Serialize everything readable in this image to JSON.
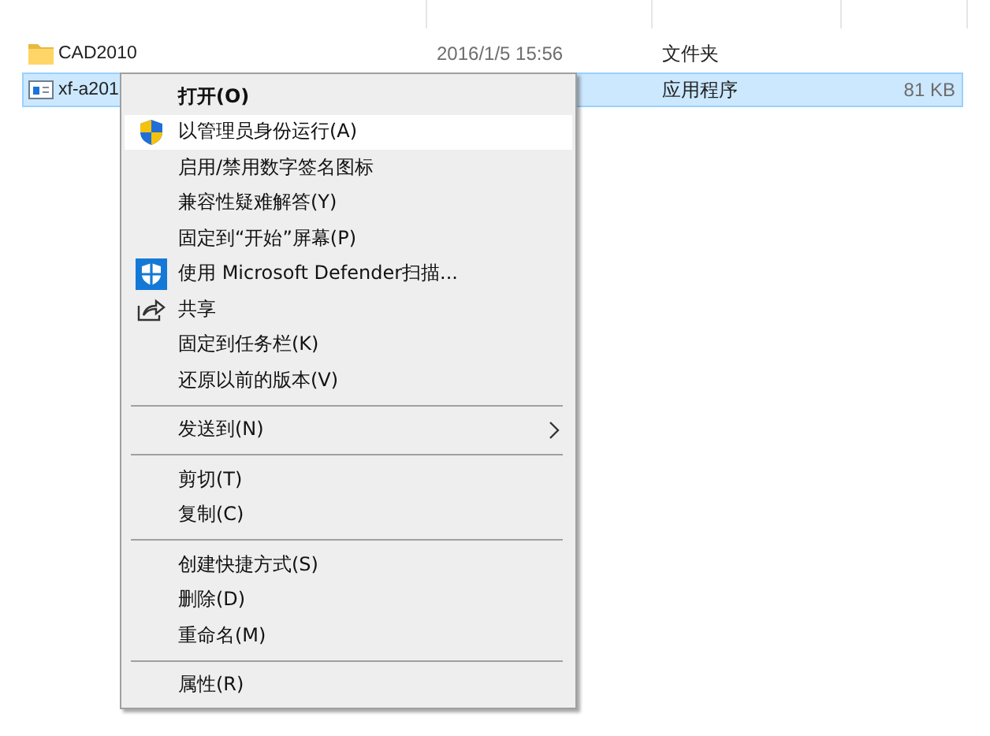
{
  "files": [
    {
      "name": "CAD2010",
      "date": "2016/1/5 15:56",
      "type": "文件夹",
      "kind": "folder",
      "selected": false
    },
    {
      "name": "xf-a201",
      "type": "应用程序",
      "size": "81 KB",
      "kind": "app",
      "selected": true
    }
  ],
  "context_menu": [
    {
      "kind": "item",
      "label": "打开(O)",
      "bold": true,
      "selected": false
    },
    {
      "kind": "shield_item",
      "label": "以管理员身份运行(A)",
      "selected": true
    },
    {
      "kind": "item",
      "label": "启用/禁用数字签名图标",
      "selected": false
    },
    {
      "kind": "item",
      "label": "兼容性疑难解答(Y)",
      "selected": false
    },
    {
      "kind": "item",
      "label": "固定到“开始”屏幕(P)",
      "selected": false
    },
    {
      "kind": "defender_item",
      "label": "使用 Microsoft Defender扫描...",
      "selected": false
    },
    {
      "kind": "share_item",
      "label": "共享",
      "selected": false
    },
    {
      "kind": "item",
      "label": "固定到任务栏(K)",
      "selected": false
    },
    {
      "kind": "item",
      "label": "还原以前的版本(V)",
      "selected": false
    },
    {
      "kind": "separator"
    },
    {
      "kind": "item",
      "label": "发送到(N)",
      "submenu": true,
      "selected": false
    },
    {
      "kind": "separator"
    },
    {
      "kind": "item",
      "label": "剪切(T)",
      "selected": false
    },
    {
      "kind": "item",
      "label": "复制(C)",
      "selected": false
    },
    {
      "kind": "separator"
    },
    {
      "kind": "item",
      "label": "创建快捷方式(S)",
      "selected": false
    },
    {
      "kind": "item",
      "label": "删除(D)",
      "selected": false
    },
    {
      "kind": "item",
      "label": "重命名(M)",
      "selected": false
    },
    {
      "kind": "separator"
    },
    {
      "kind": "item",
      "label": "属性(R)",
      "selected": false
    }
  ]
}
